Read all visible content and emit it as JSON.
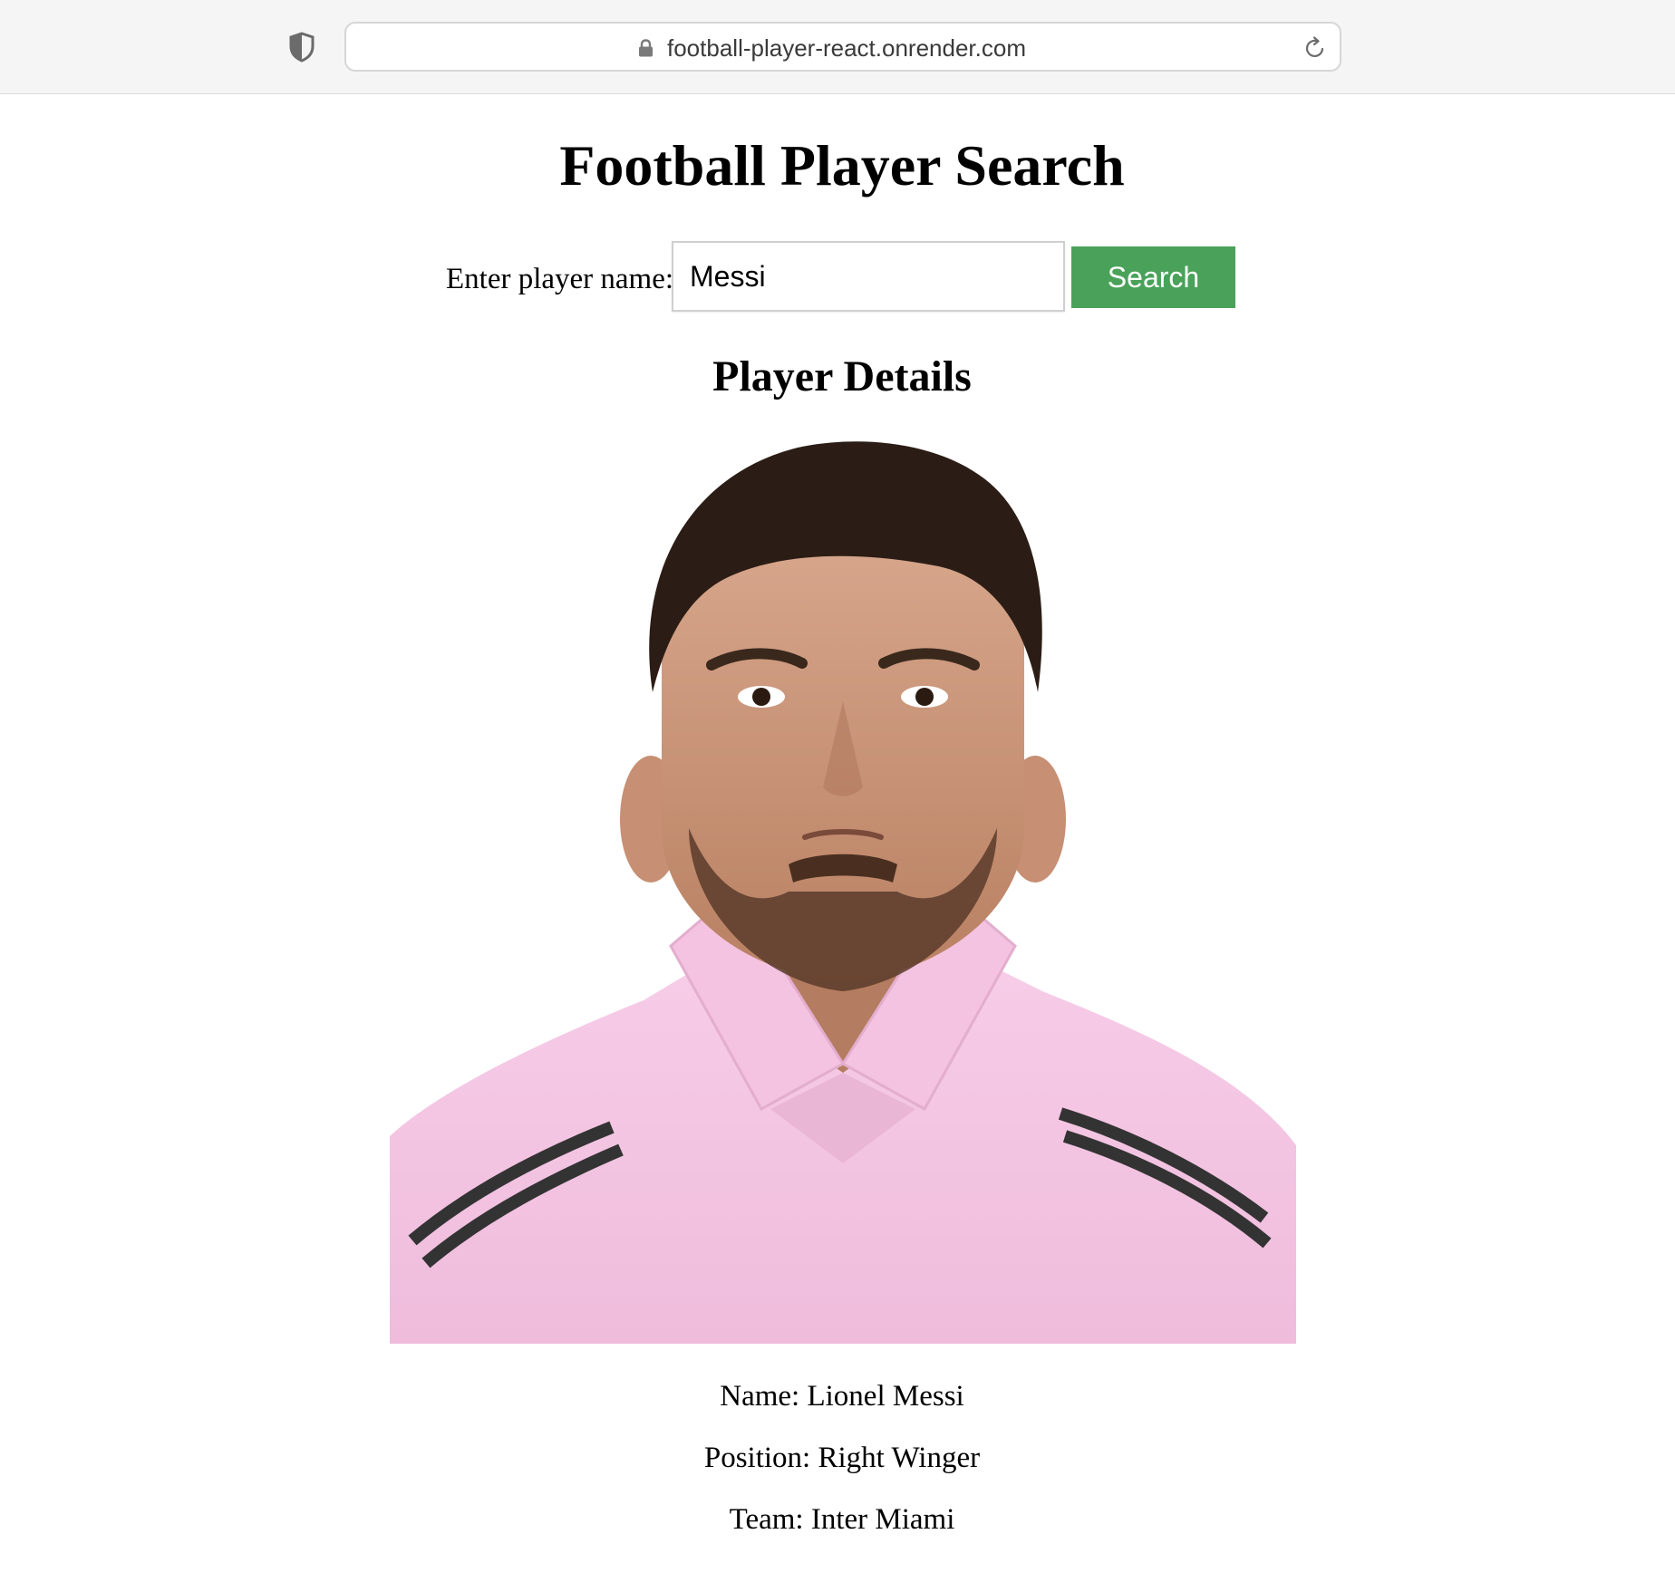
{
  "browser": {
    "url": "football-player-react.onrender.com",
    "icons": {
      "shield": "shield-icon",
      "lock": "lock-icon",
      "reload": "reload-icon"
    }
  },
  "page": {
    "title": "Football Player Search"
  },
  "search": {
    "label": "Enter player name:",
    "value": "Messi",
    "button_label": "Search",
    "button_color": "#4aa25a"
  },
  "details": {
    "heading": "Player Details",
    "name": "Name: Lionel Messi",
    "position": "Position: Right Winger",
    "team": "Team: Inter Miami",
    "photo_jersey_color": "#f4c4e2"
  }
}
